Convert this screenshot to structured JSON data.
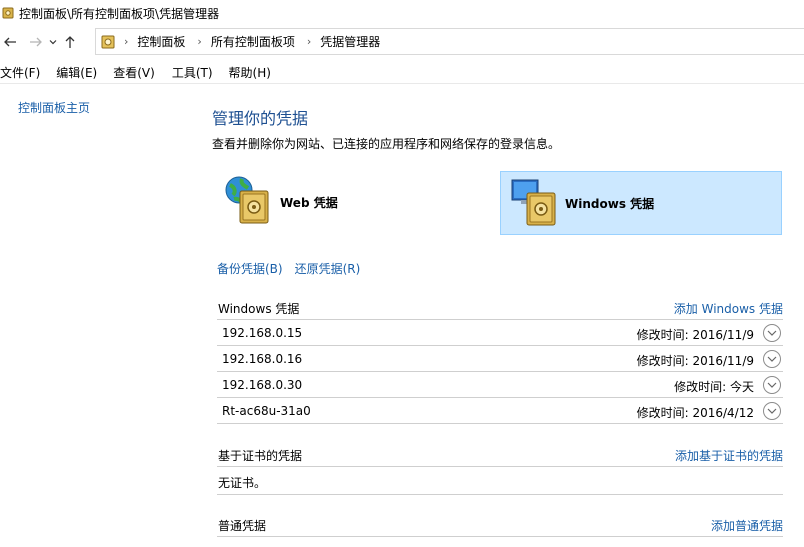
{
  "window": {
    "title": "控制面板\\所有控制面板项\\凭据管理器"
  },
  "breadcrumb": [
    "控制面板",
    "所有控制面板项",
    "凭据管理器"
  ],
  "menu": [
    "文件(F)",
    "编辑(E)",
    "查看(V)",
    "工具(T)",
    "帮助(H)"
  ],
  "sidebar": {
    "home_link": "控制面板主页"
  },
  "main": {
    "heading": "管理你的凭据",
    "description": "查看并删除你为网站、已连接的应用程序和网络保存的登录信息。",
    "tiles": {
      "web": "Web 凭据",
      "windows": "Windows 凭据"
    },
    "actions": {
      "backup": "备份凭据(B)",
      "restore": "还原凭据(R)"
    },
    "windows_section": {
      "title": "Windows 凭据",
      "add": "添加 Windows 凭据",
      "rows": [
        {
          "address": "192.168.0.15",
          "modified": "修改时间:  2016/11/9"
        },
        {
          "address": "192.168.0.16",
          "modified": "修改时间:  2016/11/9"
        },
        {
          "address": "192.168.0.30",
          "modified": "修改时间:  今天"
        },
        {
          "address": "Rt-ac68u-31a0",
          "modified": "修改时间:  2016/4/12"
        }
      ]
    },
    "cert_section": {
      "title": "基于证书的凭据",
      "add": "添加基于证书的凭据",
      "empty": "无证书。"
    },
    "generic_section": {
      "title": "普通凭据",
      "add": "添加普通凭据"
    }
  },
  "colors": {
    "link": "#1a5fa8",
    "heading": "#1d4f91",
    "selected_tile": "#cce8ff"
  }
}
